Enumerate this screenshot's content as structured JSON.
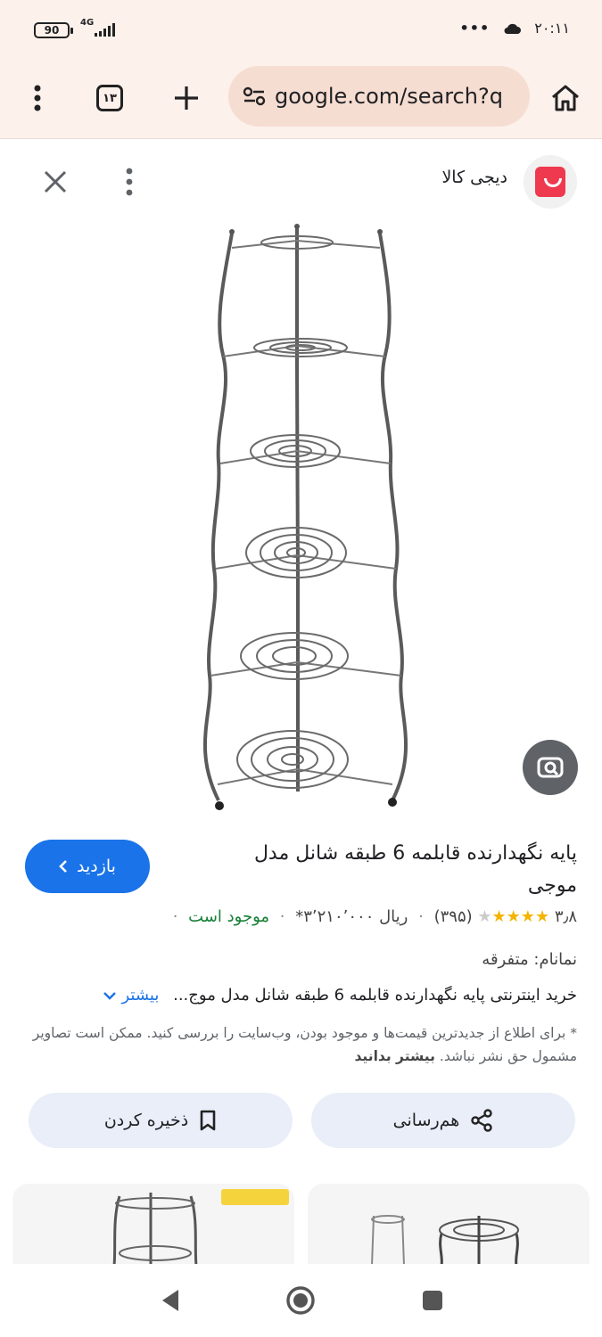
{
  "status_bar": {
    "battery": "90",
    "network": "4G",
    "more": "•••",
    "time": "۲۰:۱۱",
    "icons": [
      "battery-icon",
      "signal-icon",
      "cloud-icon"
    ]
  },
  "browser": {
    "tab_count": "۱۳",
    "url": "google.com/search?q",
    "icons": [
      "menu-icon",
      "tabs-icon",
      "new-tab-icon",
      "site-settings-icon",
      "home-icon"
    ]
  },
  "panel": {
    "site_name": "دیجی کالا",
    "icons": [
      "close-icon",
      "more-vert-icon",
      "lens-icon"
    ]
  },
  "product": {
    "title": "پایه نگهدارنده قابلمه 6 طبقه شانل مدل موجی",
    "visit_label": "بازدید",
    "rating": "۳٫۸",
    "rating_value": 3.8,
    "rating_max": 5,
    "review_count": "(۳۹۵)",
    "price": "ریال ۳٬۲۱۰٬۰۰۰*",
    "stock": "موجود است",
    "brand": "نمانام: متفرقه",
    "description": "خرید اینترنتی پایه نگهدارنده قابلمه 6 طبقه شانل مدل موج...",
    "more_label": "بیشتر",
    "note": "* برای اطلاع از جدیدترین قیمت‌ها و موجود بودن، وب‌سایت را بررسی کنید. ممکن است تصاویر مشمول حق نشر نباشد.",
    "learn_more": "بیشتر بدانید"
  },
  "actions": {
    "share_label": "هم‌رسانی",
    "save_label": "ذخیره کردن"
  },
  "colors": {
    "accent": "#1a73e8",
    "star": "#f4b400",
    "stock": "#188038",
    "brand_red": "#ef394e",
    "chrome_bg": "#fdf1ec"
  }
}
